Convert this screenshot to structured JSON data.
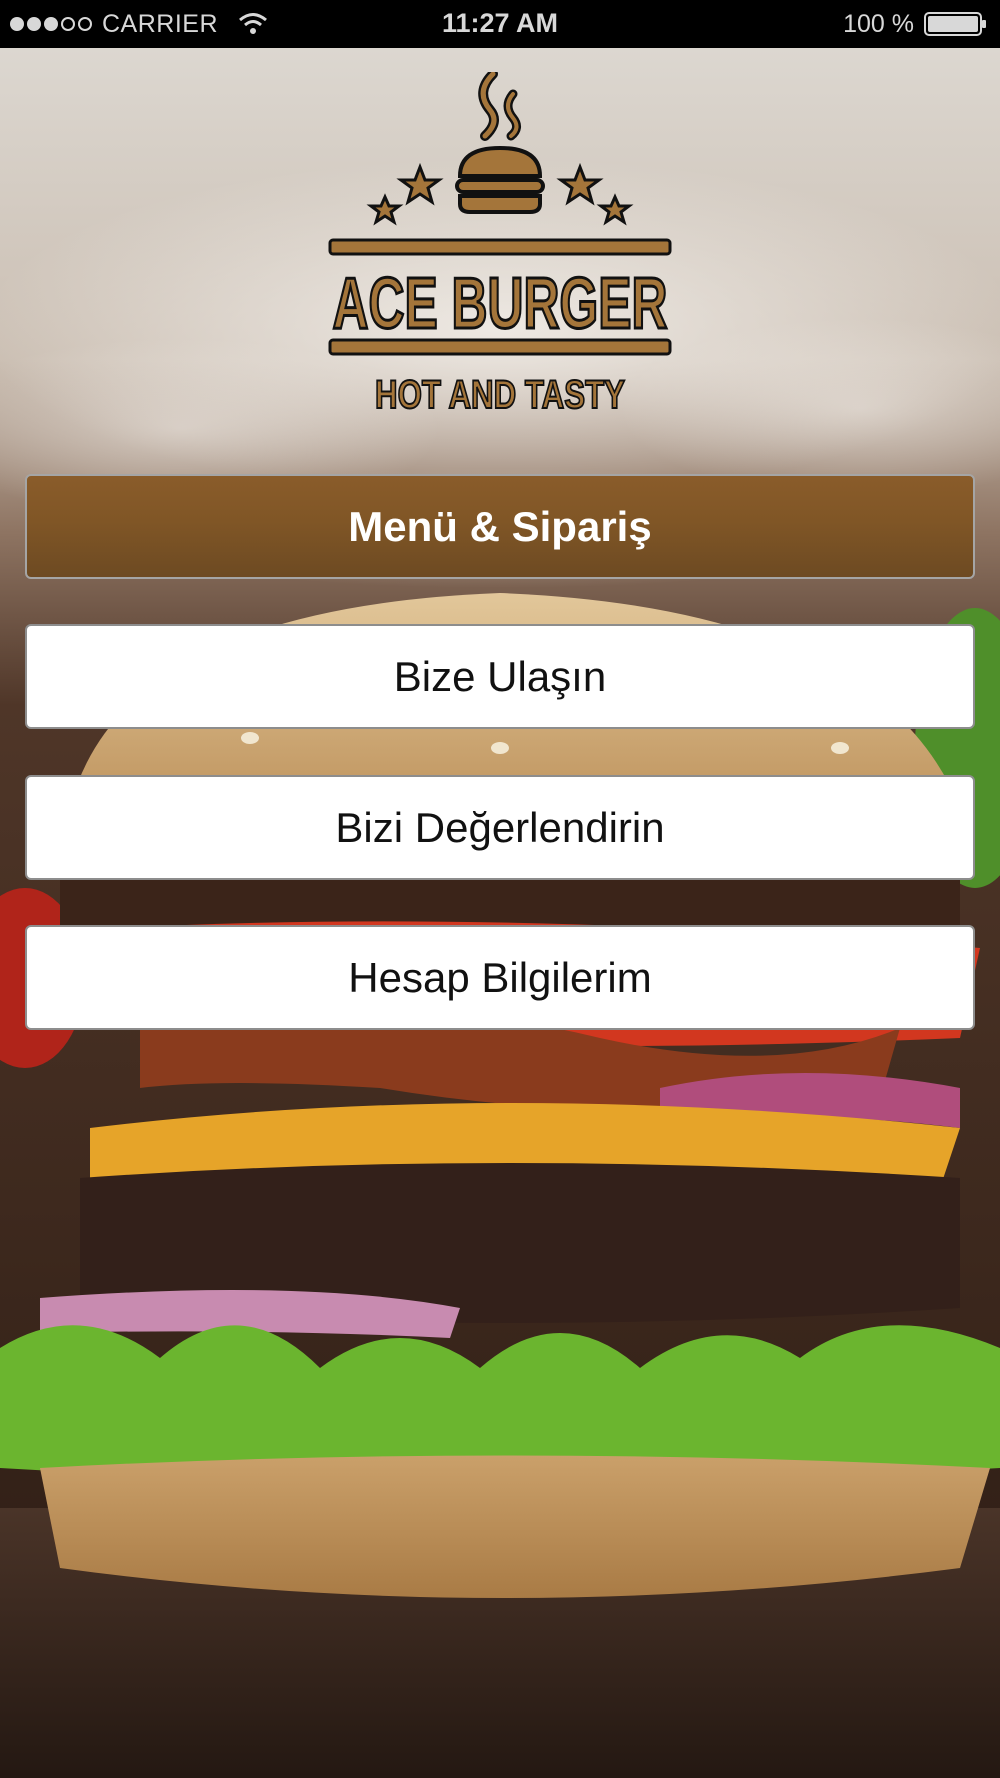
{
  "status_bar": {
    "carrier": "CARRIER",
    "time": "11:27 AM",
    "battery": "100 %",
    "signal_icon": "signal-dots-icon",
    "wifi_icon": "wifi-icon",
    "battery_icon": "battery-icon"
  },
  "logo": {
    "brand_name": "ACE BURGER",
    "tagline": "HOT AND TASTY",
    "icon": "burger-stars-logo",
    "color": "#a4753a"
  },
  "menu": {
    "items": [
      {
        "label": "Menü & Sipariş"
      },
      {
        "label": "Bize Ulaşın"
      },
      {
        "label": "Bizi Değerlendirin"
      },
      {
        "label": "Hesap Bilgilerim"
      }
    ]
  },
  "colors": {
    "primary_button": "#805626",
    "secondary_button": "#ffffff",
    "status_bar": "#000000"
  }
}
